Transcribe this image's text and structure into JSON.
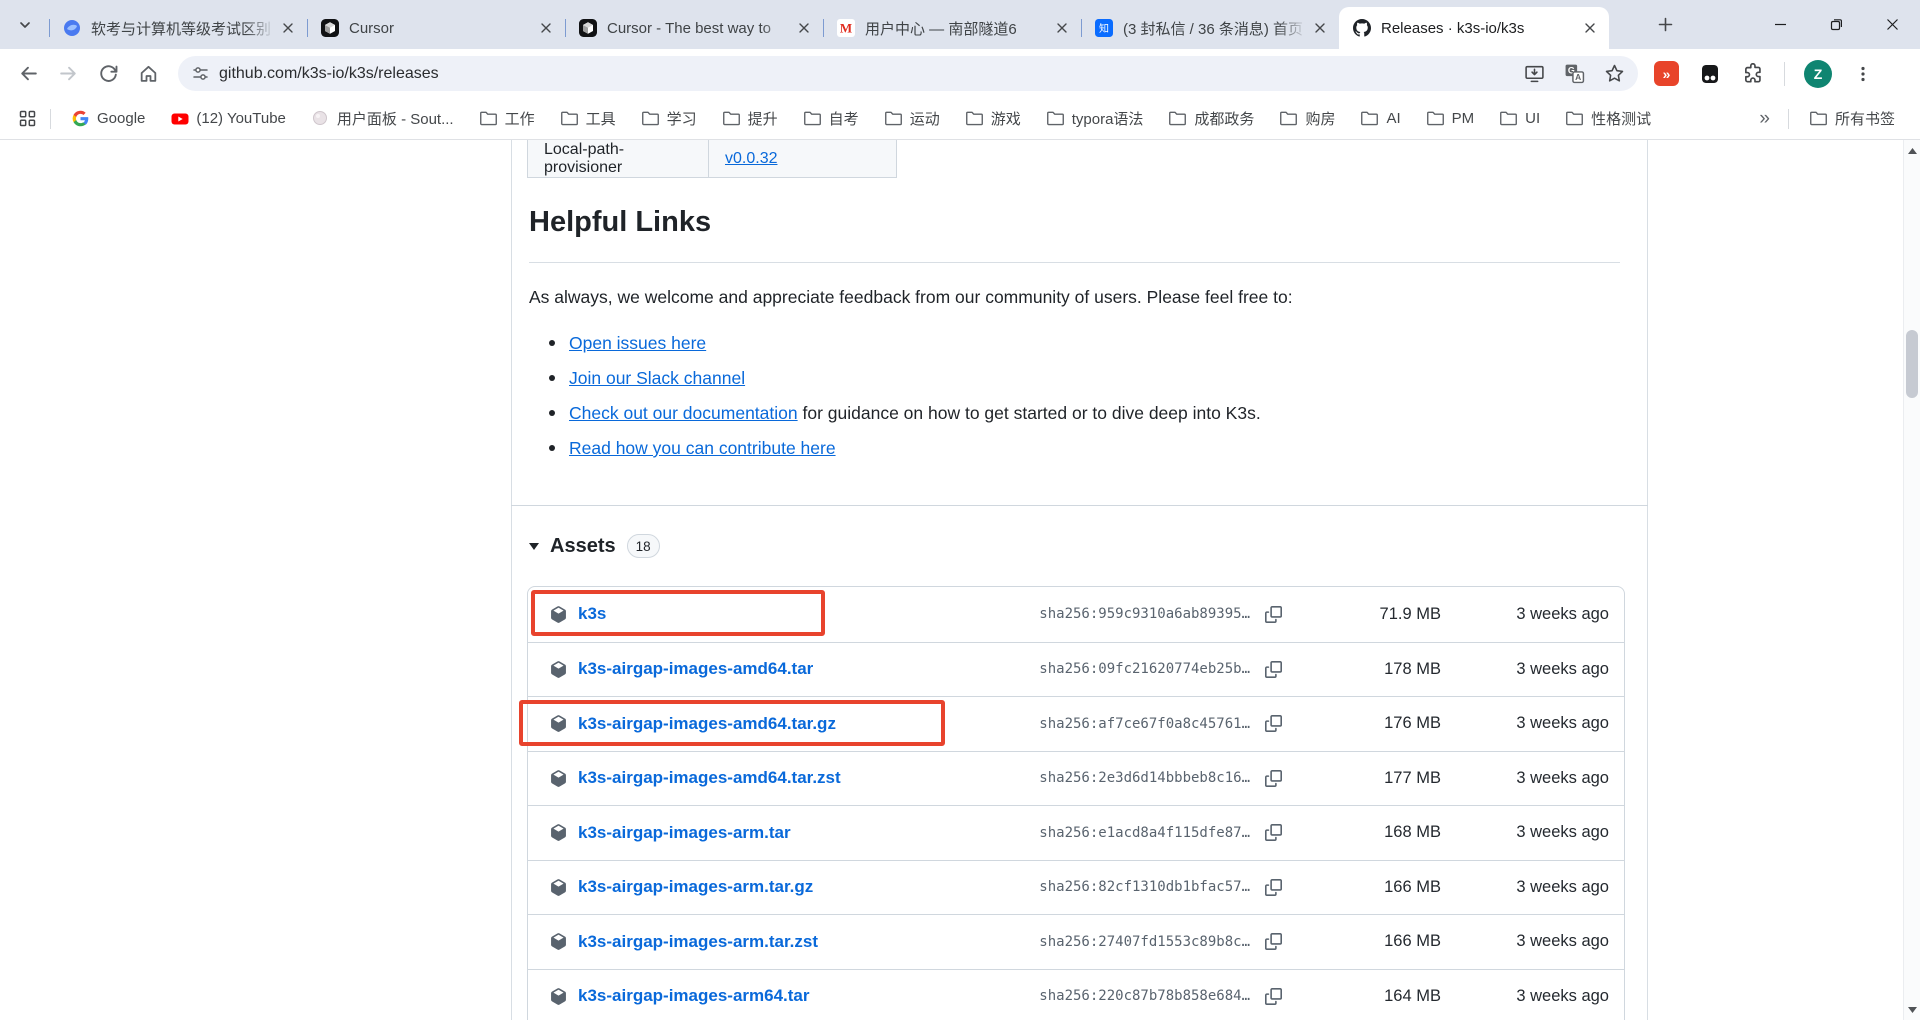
{
  "window": {
    "tabs": [
      {
        "title": "软考与计算机等级考试区别",
        "icon": "blue-swirl"
      },
      {
        "title": "Cursor",
        "icon": "cursor"
      },
      {
        "title": "Cursor - The best way to",
        "icon": "cursor"
      },
      {
        "title": "用户中心 — 南部隧道6",
        "icon": "m-red"
      },
      {
        "title": "(3 封私信 / 36 条消息) 首页",
        "icon": "zhihu"
      },
      {
        "title": "Releases · k3s-io/k3s",
        "icon": "github",
        "active": true
      }
    ]
  },
  "toolbar": {
    "url": "github.com/k3s-io/k3s/releases",
    "avatar": "Z"
  },
  "bookmarks": {
    "items": [
      {
        "label": "Google",
        "icon": "google"
      },
      {
        "label": "(12) YouTube",
        "icon": "youtube"
      },
      {
        "label": "用户面板 - Sout...",
        "icon": "pearl"
      },
      {
        "label": "工作",
        "icon": "folder"
      },
      {
        "label": "工具",
        "icon": "folder"
      },
      {
        "label": "学习",
        "icon": "folder"
      },
      {
        "label": "提升",
        "icon": "folder"
      },
      {
        "label": "自考",
        "icon": "folder"
      },
      {
        "label": "运动",
        "icon": "folder"
      },
      {
        "label": "游戏",
        "icon": "folder"
      },
      {
        "label": "typora语法",
        "icon": "folder"
      },
      {
        "label": "成都政务",
        "icon": "folder"
      },
      {
        "label": "购房",
        "icon": "folder"
      },
      {
        "label": "AI",
        "icon": "folder"
      },
      {
        "label": "PM",
        "icon": "folder"
      },
      {
        "label": "UI",
        "icon": "folder"
      },
      {
        "label": "性格测试",
        "icon": "folder"
      }
    ],
    "overflow": "»",
    "all_bookmarks_label": "所有书签"
  },
  "page": {
    "version_row": {
      "component": "Local-path-provisioner",
      "version": "v0.0.32"
    },
    "helpful": {
      "title": "Helpful Links",
      "intro": "As always, we welcome and appreciate feedback from our community of users. Please feel free to:",
      "links": [
        {
          "text": "Open issues here"
        },
        {
          "text": "Join our Slack channel"
        },
        {
          "text": "Check out our documentation",
          "suffix": " for guidance on how to get started or to dive deep into K3s."
        },
        {
          "text": "Read how you can contribute here"
        }
      ]
    },
    "assets": {
      "title": "Assets",
      "count": "18",
      "rows": [
        {
          "name": "k3s",
          "sha": "sha256:959c9310a6ab89395…",
          "size": "71.9 MB",
          "age": "3 weeks ago"
        },
        {
          "name": "k3s-airgap-images-amd64.tar",
          "sha": "sha256:09fc21620774eb25b…",
          "size": "178 MB",
          "age": "3 weeks ago"
        },
        {
          "name": "k3s-airgap-images-amd64.tar.gz",
          "sha": "sha256:af7ce67f0a8c45761…",
          "size": "176 MB",
          "age": "3 weeks ago"
        },
        {
          "name": "k3s-airgap-images-amd64.tar.zst",
          "sha": "sha256:2e3d6d14bbbeb8c16…",
          "size": "177 MB",
          "age": "3 weeks ago"
        },
        {
          "name": "k3s-airgap-images-arm.tar",
          "sha": "sha256:e1acd8a4f115dfe87…",
          "size": "168 MB",
          "age": "3 weeks ago"
        },
        {
          "name": "k3s-airgap-images-arm.tar.gz",
          "sha": "sha256:82cf1310db1bfac57…",
          "size": "166 MB",
          "age": "3 weeks ago"
        },
        {
          "name": "k3s-airgap-images-arm.tar.zst",
          "sha": "sha256:27407fd1553c89b8c…",
          "size": "166 MB",
          "age": "3 weeks ago"
        },
        {
          "name": "k3s-airgap-images-arm64.tar",
          "sha": "sha256:220c87b78b858e684…",
          "size": "164 MB",
          "age": "3 weeks ago"
        }
      ]
    }
  },
  "colors": {
    "link": "#0969da",
    "annotation": "#e8432d",
    "border": "#d0d7de",
    "muted": "#59636e"
  }
}
